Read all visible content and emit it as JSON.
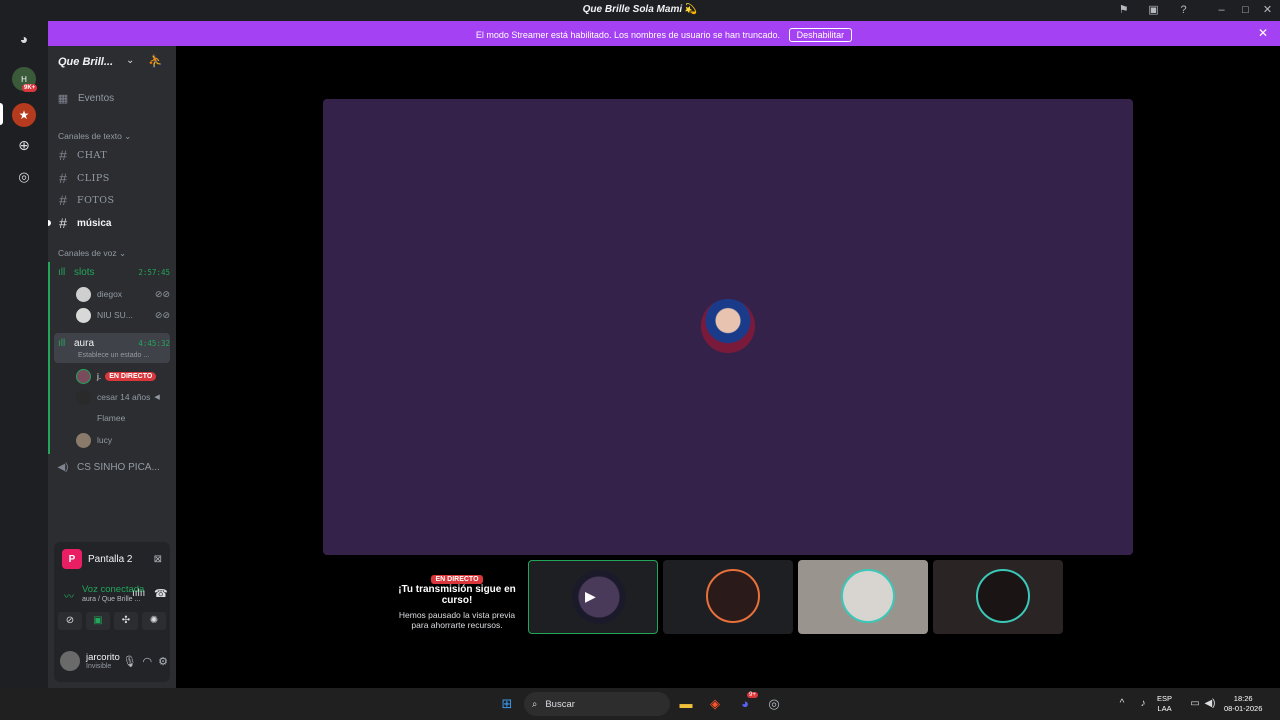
{
  "window": {
    "title": "Que Brille Sola Mami",
    "title_emoji": "💫"
  },
  "banner": {
    "message": "El modo Streamer está habilitado. Los nombres de usuario se han truncado.",
    "button": "Deshabilitar"
  },
  "servers": {
    "badge": "9K+"
  },
  "sidebar": {
    "server_name": "Que Brill...",
    "events": "Eventos",
    "text_category": "Canales de texto",
    "text_channels": [
      "CHAT",
      "CLIPS",
      "FOTOS",
      "música"
    ],
    "voice_category": "Canales de voz",
    "voice": [
      {
        "name": "slots",
        "time": "2:57:45",
        "users": [
          "diegox",
          "NIU SU..."
        ]
      },
      {
        "name": "aura",
        "time": "4:45:32",
        "status": "Establece un estado ...",
        "users": [
          "j.",
          "cesar 14 años",
          "Flamee",
          "lucy"
        ],
        "live_label": "EN DIRECTO"
      }
    ],
    "other_voice": "CS SINHO PICA..."
  },
  "panel": {
    "screen_letter": "P",
    "screen_name": "Pantalla 2",
    "voice_status": "Voz conectada",
    "voice_location": "aura / Que Brille ...",
    "username": "jarcorito",
    "user_status": "Invisible"
  },
  "stream": {
    "live_tag": "EN DIRECTO",
    "heading": "¡Tu transmisión sigue en curso!",
    "paragraph": "Hemos pausado la vista previa para ahorrarte recursos."
  },
  "taskbar": {
    "search": "Buscar",
    "lang": "ESP",
    "layout": "LAA",
    "time": "18:26",
    "date": "08-01-2026",
    "discord_badge": "9+"
  },
  "colors": {
    "accent": "#a442f3",
    "voice_green": "#23a55a",
    "stage_bg": "#35224a",
    "live_red": "#da373c"
  }
}
